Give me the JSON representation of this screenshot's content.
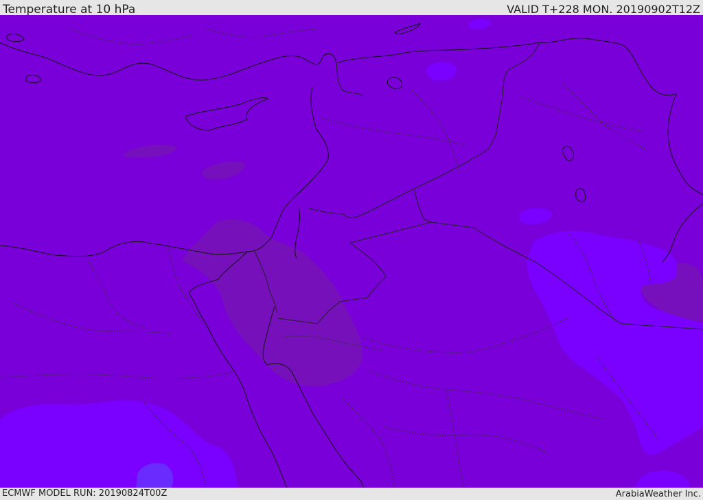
{
  "header": {
    "title": "Temperature at 10 hPa",
    "valid": "VALID T+228 MON. 20190902T12Z"
  },
  "footer": {
    "model_run": "ECMWF MODEL RUN: 20190824T00Z",
    "credit": "ArabiaWeather Inc."
  },
  "colors": {
    "base_field": "#7a00da",
    "warm_field": "#7611b8",
    "cool_field": "#7a00ff",
    "cold_spot": "#6a2bff",
    "coastline": "#111111",
    "borders": "#222222"
  }
}
